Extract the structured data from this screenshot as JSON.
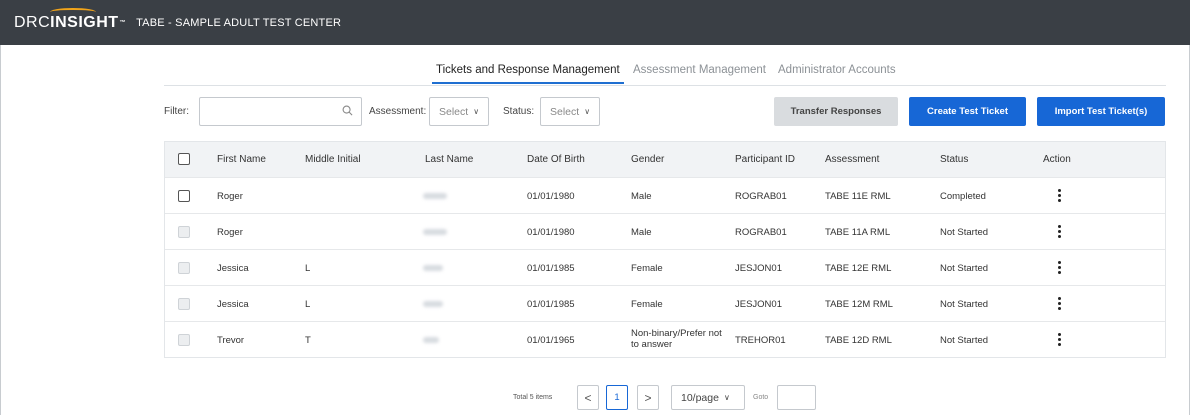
{
  "header": {
    "logo_drc": "DRC",
    "logo_insight": "INSIGHT",
    "logo_tm": "™",
    "center_name": "TABE - SAMPLE ADULT TEST CENTER",
    "background": "#3a3f45"
  },
  "tabs": [
    {
      "label": "Tickets and Response Management",
      "active": true
    },
    {
      "label": "Assessment Management",
      "active": false
    },
    {
      "label": "Administrator Accounts",
      "active": false
    }
  ],
  "filters": {
    "filter_label": "Filter:",
    "search_value": "",
    "search_icon": "search-icon",
    "assessment_label": "Assessment:",
    "assessment_value": "Select",
    "status_label": "Status:",
    "status_value": "Select"
  },
  "buttons": {
    "transfer": "Transfer Responses",
    "create": "Create Test Ticket",
    "import": "Import Test Ticket(s)",
    "primary_color": "#1767d6",
    "disabled_color": "#d9dcdf"
  },
  "table": {
    "columns": [
      "First Name",
      "Middle Initial",
      "Last Name",
      "Date Of Birth",
      "Gender",
      "Participant ID",
      "Assessment",
      "Status",
      "Action"
    ],
    "rows": [
      {
        "first": "Roger",
        "middle": "",
        "dob": "01/01/1980",
        "gender": "Male",
        "pid": "ROGRAB01",
        "assessment": "TABE 11E RML",
        "status": "Completed",
        "enabled": true
      },
      {
        "first": "Roger",
        "middle": "",
        "dob": "01/01/1980",
        "gender": "Male",
        "pid": "ROGRAB01",
        "assessment": "TABE 11A RML",
        "status": "Not Started",
        "enabled": false
      },
      {
        "first": "Jessica",
        "middle": "L",
        "dob": "01/01/1985",
        "gender": "Female",
        "pid": "JESJON01",
        "assessment": "TABE 12E RML",
        "status": "Not Started",
        "enabled": false
      },
      {
        "first": "Jessica",
        "middle": "L",
        "dob": "01/01/1985",
        "gender": "Female",
        "pid": "JESJON01",
        "assessment": "TABE 12M RML",
        "status": "Not Started",
        "enabled": false
      },
      {
        "first": "Trevor",
        "middle": "T",
        "dob": "01/01/1965",
        "gender": "Non-binary/Prefer not to answer",
        "pid": "TREHOR01",
        "assessment": "TABE 12D RML",
        "status": "Not Started",
        "enabled": false
      }
    ],
    "action_icon": "kebab-menu-icon"
  },
  "pagination": {
    "total": "Total 5 items",
    "prev": "<",
    "current_page": "1",
    "next": ">",
    "page_size": "10/page",
    "goto_label": "Goto",
    "goto_value": ""
  }
}
